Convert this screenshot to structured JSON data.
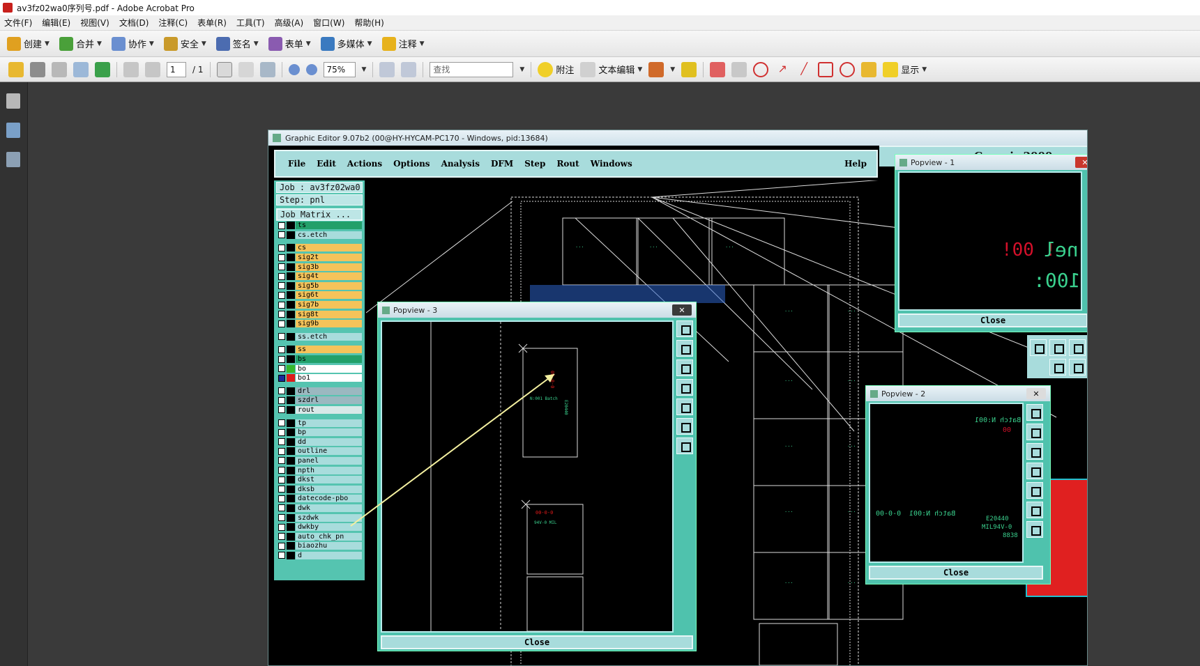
{
  "window": {
    "title": "av3fz02wa0序列号.pdf - Adobe Acrobat Pro"
  },
  "menu": [
    "文件(F)",
    "编辑(E)",
    "视图(V)",
    "文档(D)",
    "注释(C)",
    "表单(R)",
    "工具(T)",
    "高级(A)",
    "窗口(W)",
    "帮助(H)"
  ],
  "toolbar1": [
    {
      "label": "创建",
      "icon": "create-icon",
      "color": "#e0a020"
    },
    {
      "label": "合并",
      "icon": "combine-icon",
      "color": "#4aa03a"
    },
    {
      "label": "协作",
      "icon": "collaborate-icon",
      "color": "#6a8fd0"
    },
    {
      "label": "安全",
      "icon": "lock-icon",
      "color": "#c99a2a"
    },
    {
      "label": "签名",
      "icon": "pen-icon",
      "color": "#4c6cb0"
    },
    {
      "label": "表单",
      "icon": "form-icon",
      "color": "#8a5bb0"
    },
    {
      "label": "多媒体",
      "icon": "multimedia-icon",
      "color": "#3a7ac0"
    },
    {
      "label": "注释",
      "icon": "comment-icon",
      "color": "#e7b21c"
    }
  ],
  "toolbar2": {
    "page_current": "1",
    "page_total": "/ 1",
    "zoom": "75%",
    "search_placeholder": "查找",
    "sticky_note_label": "附注",
    "text_edit_label": "文本编辑",
    "show_label": "显示"
  },
  "editor": {
    "title": "Graphic Editor 9.07b2 (00@HY-HYCAM-PC170 - Windows, pid:13684)",
    "menu": [
      "File",
      "Edit",
      "Actions",
      "Options",
      "Analysis",
      "DFM",
      "Step",
      "Rout",
      "Windows"
    ],
    "help": "Help",
    "job": "Job : av3fz02wa0",
    "step": "Step: pnl",
    "job_matrix": "Job Matrix ...",
    "colors": {
      "signal": "#f5c35a",
      "ts": "#22a06a",
      "drill": "#9bb8c0",
      "doc": "#a8dcdc",
      "selected": "#ffffff"
    }
  },
  "layers": [
    {
      "name": "ts",
      "group": 1,
      "bg": "#22a06a"
    },
    {
      "name": "cs.etch",
      "group": 1,
      "bg": "#a8dcdc"
    },
    {
      "name": "cs",
      "group": 2,
      "bg": "#f5c35a"
    },
    {
      "name": "sig2t",
      "group": 2,
      "bg": "#f5c35a"
    },
    {
      "name": "sig3b",
      "group": 2,
      "bg": "#f5c35a"
    },
    {
      "name": "sig4t",
      "group": 2,
      "bg": "#f5c35a"
    },
    {
      "name": "sig5b",
      "group": 2,
      "bg": "#f5c35a"
    },
    {
      "name": "sig6t",
      "group": 2,
      "bg": "#f5c35a"
    },
    {
      "name": "sig7b",
      "group": 2,
      "bg": "#f5c35a"
    },
    {
      "name": "sig8t",
      "group": 2,
      "bg": "#f5c35a"
    },
    {
      "name": "sig9b",
      "group": 2,
      "bg": "#f5c35a"
    },
    {
      "name": "ss.etch",
      "group": 3,
      "bg": "#a8dcdc"
    },
    {
      "name": "ss",
      "group": 4,
      "bg": "#f5c35a"
    },
    {
      "name": "bs",
      "group": 4,
      "bg": "#22a06a"
    },
    {
      "name": "bo",
      "group": 4,
      "bg": "#ffffff",
      "swatch": "#37b82c"
    },
    {
      "name": "bo1",
      "group": 4,
      "bg": "#ffffff",
      "swatch": "#e01a1a",
      "selected": true
    },
    {
      "name": "drl",
      "group": 5,
      "bg": "#9bb8c0"
    },
    {
      "name": "szdrl",
      "group": 5,
      "bg": "#9bb8c0"
    },
    {
      "name": "rout",
      "group": 5,
      "bg": "#d8e8e8"
    },
    {
      "name": "tp",
      "group": 6,
      "bg": "#a8dcdc"
    },
    {
      "name": "bp",
      "group": 6,
      "bg": "#a8dcdc"
    },
    {
      "name": "dd",
      "group": 6,
      "bg": "#a8dcdc"
    },
    {
      "name": "outline",
      "group": 6,
      "bg": "#a8dcdc"
    },
    {
      "name": "panel",
      "group": 6,
      "bg": "#a8dcdc"
    },
    {
      "name": "npth",
      "group": 6,
      "bg": "#a8dcdc"
    },
    {
      "name": "dkst",
      "group": 6,
      "bg": "#a8dcdc"
    },
    {
      "name": "dksb",
      "group": 6,
      "bg": "#a8dcdc"
    },
    {
      "name": "datecode-pbo",
      "group": 6,
      "bg": "#a8dcdc"
    },
    {
      "name": "dwk",
      "group": 6,
      "bg": "#a8dcdc"
    },
    {
      "name": "szdwk",
      "group": 6,
      "bg": "#a8dcdc"
    },
    {
      "name": "dwkby",
      "group": 6,
      "bg": "#a8dcdc"
    },
    {
      "name": "auto_chk_pn",
      "group": 6,
      "bg": "#a8dcdc"
    },
    {
      "name": "biaozhu",
      "group": 6,
      "bg": "#a8dcdc"
    },
    {
      "name": "d",
      "group": 6,
      "bg": "#a8dcdc"
    }
  ],
  "popup1": {
    "title": "Popview - 1",
    "close": "Close",
    "text_a": "!00 !",
    "text_b": "nel",
    "text_c": "100:"
  },
  "popup2": {
    "title": "Popview - 2",
    "close": "Close",
    "line1": "Batch N:001",
    "line2": "00",
    "line3": "Batch N:001",
    "line4": "00-0-0",
    "line5": "E20440",
    "line6": "MIL94V-0",
    "line7": "8838"
  },
  "popup3": {
    "title": "Popview - 3",
    "close": "Close"
  },
  "genesis_label": "Genesis 2000"
}
